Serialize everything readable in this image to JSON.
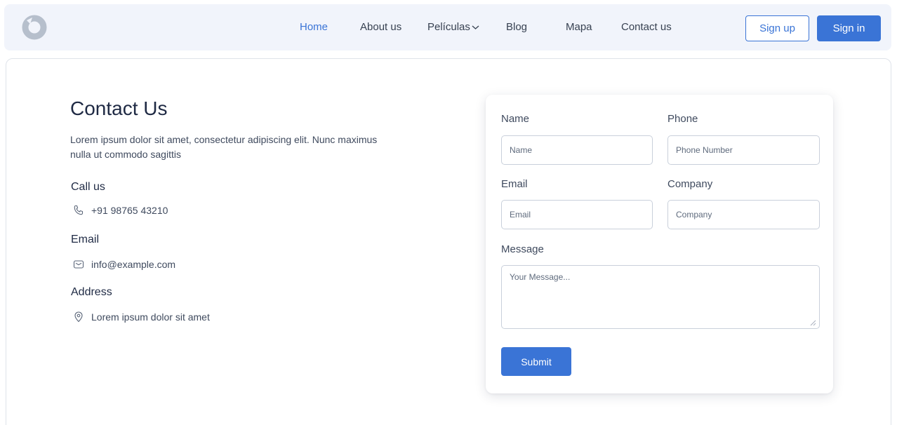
{
  "nav": {
    "logo_icon": "ring-logo-icon",
    "links": [
      {
        "label": "Home",
        "active": true
      },
      {
        "label": "About us",
        "active": false
      },
      {
        "label": "Películas",
        "active": false,
        "has_dropdown": true
      },
      {
        "label": "Blog",
        "active": false
      },
      {
        "label": "Mapa",
        "active": false
      },
      {
        "label": "Contact us",
        "active": false
      }
    ],
    "sign_up_label": "Sign up",
    "sign_in_label": "Sign in"
  },
  "contact": {
    "title": "Contact Us",
    "description": "Lorem ipsum dolor sit amet, consectetur adipiscing elit. Nunc maximus nulla ut commodo sagittis",
    "call_label": "Call us",
    "phone": "+91 98765 43210",
    "email_label": "Email",
    "email": "info@example.com",
    "address_label": "Address",
    "address": "Lorem ipsum dolor sit amet"
  },
  "form": {
    "name_label": "Name",
    "name_placeholder": "Name",
    "phone_label": "Phone",
    "phone_placeholder": "Phone Number",
    "email_label": "Email",
    "email_placeholder": "Email",
    "company_label": "Company",
    "company_placeholder": "Company",
    "message_label": "Message",
    "message_placeholder": "Your Message...",
    "submit_label": "Submit"
  },
  "colors": {
    "accent": "#3a74d6",
    "nav_background": "#f1f4fb",
    "heading": "#1f2a44"
  }
}
